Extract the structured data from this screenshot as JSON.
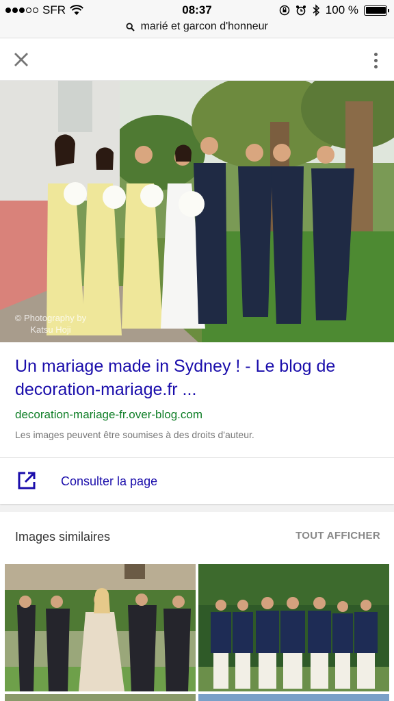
{
  "status_bar": {
    "carrier": "SFR",
    "time": "08:37",
    "battery": "100 %",
    "battery_level": 1.0
  },
  "search": {
    "query": "marié et garcon d'honneur"
  },
  "result": {
    "title": "Un mariage made in Sydney ! - Le blog de decoration-mariage.fr ...",
    "domain": "decoration-mariage-fr.over-blog.com",
    "notice": "Les images peuvent être soumises à des droits d'auteur.",
    "visit_label": "Consulter la page",
    "watermark": "© Photography by Katsu Hoji"
  },
  "similar": {
    "title": "Images similaires",
    "see_all": "TOUT AFFICHER"
  },
  "colors": {
    "link": "#1a0dab",
    "domain": "#0d7d25"
  },
  "icons": {
    "close": "close-icon",
    "menu": "more-vert-icon",
    "visit": "open-in-new-icon",
    "search": "search-icon"
  }
}
